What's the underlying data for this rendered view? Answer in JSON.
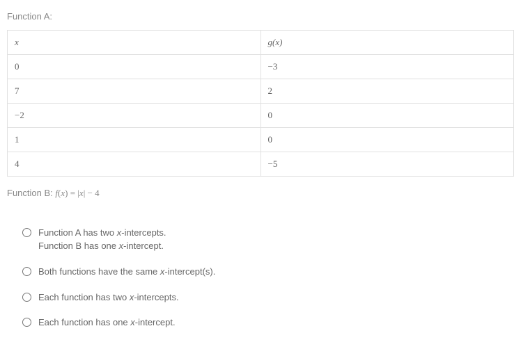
{
  "functionA": {
    "label": "Function A:",
    "table": {
      "header_x": "x",
      "header_gx_g": "g",
      "header_gx_paren_open": "(",
      "header_gx_x": "x",
      "header_gx_paren_close": ")",
      "rows": [
        {
          "x": "0",
          "gx": "−3"
        },
        {
          "x": "7",
          "gx": "2"
        },
        {
          "x": "−2",
          "gx": "0"
        },
        {
          "x": "1",
          "gx": "0"
        },
        {
          "x": "4",
          "gx": "−5"
        }
      ]
    }
  },
  "functionB": {
    "label_prefix": "Function B: ",
    "f": "f",
    "po": "(",
    "x1": "x",
    "pc": ")",
    "eq": " = |",
    "x2": "x",
    "tail": "| − 4"
  },
  "options": [
    {
      "lines": [
        {
          "pre": "Function A has two ",
          "xword": "x",
          "post": "-intercepts."
        },
        {
          "pre": "Function B has one ",
          "xword": "x",
          "post": "-intercept."
        }
      ]
    },
    {
      "lines": [
        {
          "pre": "Both functions have the same ",
          "xword": "x",
          "post": "-intercept(s)."
        }
      ]
    },
    {
      "lines": [
        {
          "pre": "Each function has two ",
          "xword": "x",
          "post": "-intercepts."
        }
      ]
    },
    {
      "lines": [
        {
          "pre": "Each function has one ",
          "xword": "x",
          "post": "-intercept."
        }
      ]
    }
  ],
  "chart_data": {
    "type": "table",
    "title": "Function A values",
    "columns": [
      "x",
      "g(x)"
    ],
    "rows": [
      [
        0,
        -3
      ],
      [
        7,
        2
      ],
      [
        -2,
        0
      ],
      [
        1,
        0
      ],
      [
        4,
        -5
      ]
    ],
    "functionB_formula": "f(x) = |x| - 4"
  }
}
